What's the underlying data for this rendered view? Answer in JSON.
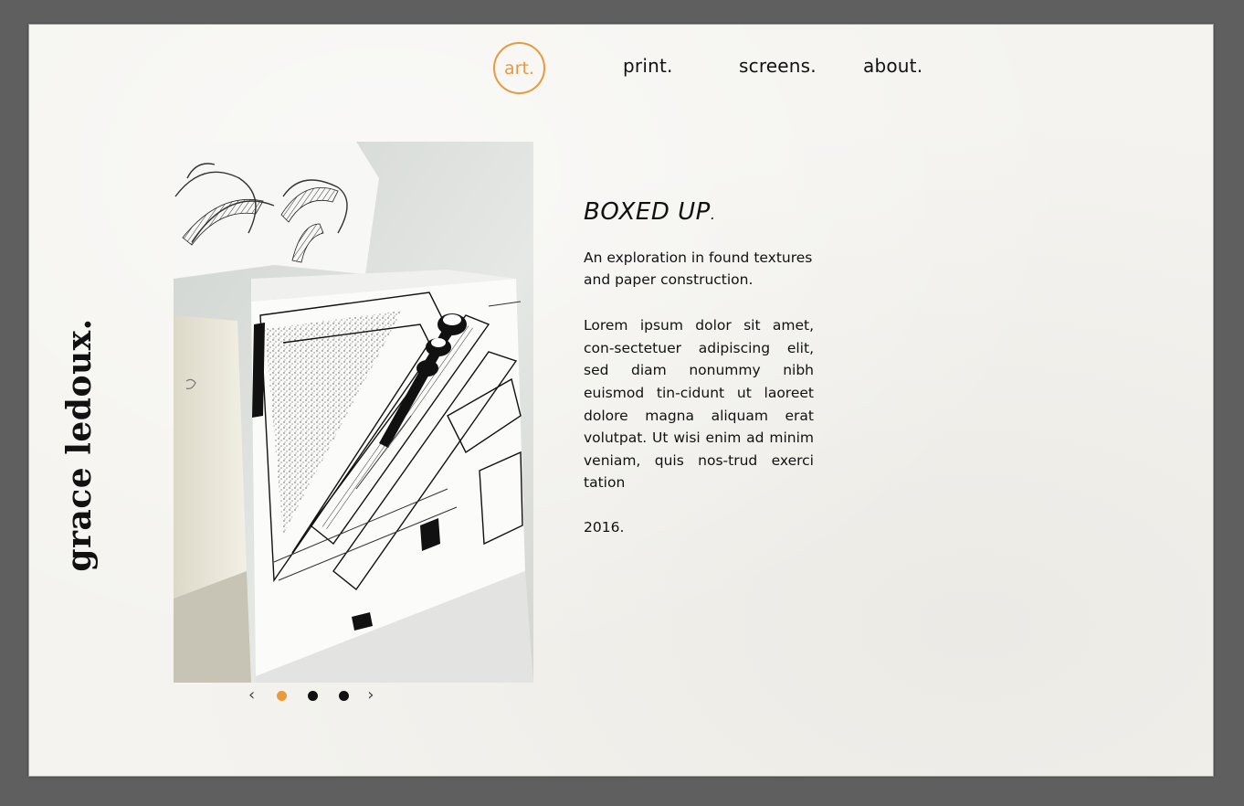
{
  "site": {
    "name": "grace ledoux."
  },
  "nav": {
    "items": [
      {
        "label": "art.",
        "active": true
      },
      {
        "label": "print.",
        "active": false
      },
      {
        "label": "screens.",
        "active": false
      },
      {
        "label": "about.",
        "active": false
      }
    ]
  },
  "project": {
    "title": "BOXED UP",
    "title_suffix": ".",
    "subtitle": "An exploration in found textures and paper construction.",
    "body": "Lorem ipsum dolor sit amet, con-sectetuer adipiscing elit, sed diam nonummy nibh euismod tin-cidunt ut laoreet dolore magna aliquam erat volutpat. Ut wisi enim ad minim veniam, quis nos-trud exerci tation",
    "year": "2016."
  },
  "carousel": {
    "prev_icon": "chevron-left-icon",
    "next_icon": "chevron-right-icon",
    "prev_glyph": "‹",
    "next_glyph": "›",
    "slides": 3,
    "active_index": 0
  },
  "colors": {
    "accent": "#e99a3c",
    "background": "#5f5f5f",
    "paper": "#f4f3ef",
    "text": "#111111"
  }
}
